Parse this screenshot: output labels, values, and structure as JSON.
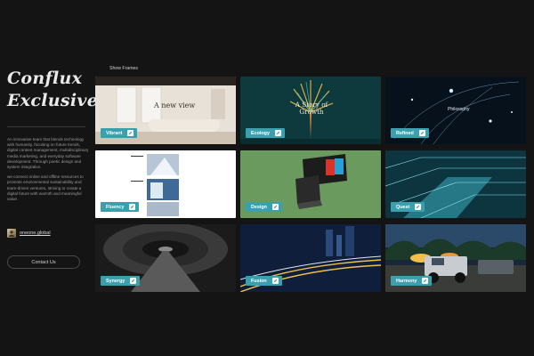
{
  "brand": {
    "line1": "Conflux",
    "line2": "Exclusive"
  },
  "description": [
    "An innovative team that blends technology with humanity, focusing on future trends, digital content management, multidisciplinary media marketing, and everyday software development. Through poetic design and system integration.",
    "we connect online and offline resources to promote environmental sustainability and team-driven ventures, striving to create a digital future with warmth and meaningful value."
  ],
  "account": {
    "name": "oneone.global"
  },
  "contact_label": "Contact Us",
  "frames_label": "Show Frames",
  "cards": [
    {
      "label": "Vibrant",
      "overlay": "A new view"
    },
    {
      "label": "Ecology",
      "overlay": "A Story of Growth"
    },
    {
      "label": "Refined",
      "overlay": "Philosophy"
    },
    {
      "label": "Fluency",
      "overlay": ""
    },
    {
      "label": "Design",
      "overlay": ""
    },
    {
      "label": "Quest",
      "overlay": ""
    },
    {
      "label": "Synergy",
      "overlay": ""
    },
    {
      "label": "Fusion",
      "overlay": ""
    },
    {
      "label": "Harmony",
      "overlay": ""
    }
  ],
  "colors": {
    "background": "#141414",
    "badge": "#3aa0ad"
  },
  "icons": {
    "badge": "edit-icon"
  }
}
